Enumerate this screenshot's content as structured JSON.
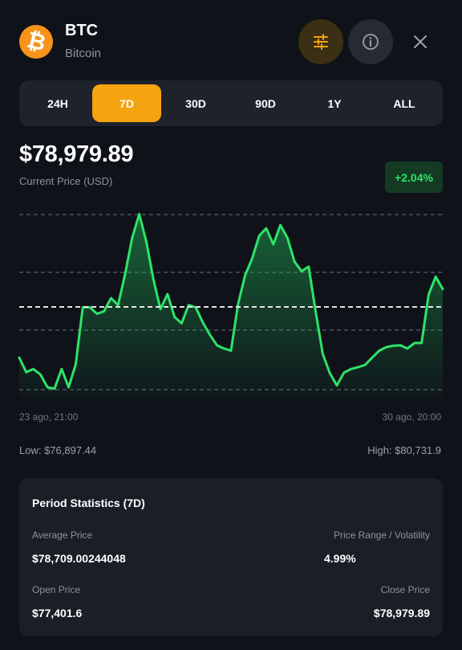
{
  "header": {
    "symbol": "BTC",
    "name": "Bitcoin",
    "logo_glyph": "₿",
    "icons": {
      "filter": "sliders-icon",
      "info": "info-icon",
      "close": "close-icon"
    },
    "colors": {
      "bitcoin": "#f7931a",
      "accent": "#f5a30f"
    }
  },
  "tabs": [
    {
      "label": "24H",
      "active": false
    },
    {
      "label": "7D",
      "active": true
    },
    {
      "label": "30D",
      "active": false
    },
    {
      "label": "90D",
      "active": false
    },
    {
      "label": "1Y",
      "active": false
    },
    {
      "label": "ALL",
      "active": false
    }
  ],
  "price": {
    "value": "$78,979.89",
    "label": "Current Price (USD)",
    "change": "+2.04%",
    "change_color": "#2ee36a"
  },
  "chart": {
    "x_start_label": "23 ago, 21:00",
    "x_end_label": "30 ago, 20:00",
    "low_label": "Low: $76,897.44",
    "high_label": "High: $80,731.9"
  },
  "chart_data": {
    "type": "area",
    "x_start": "23 ago, 21:00",
    "x_end": "30 ago, 20:00",
    "ylim": [
      76897.44,
      80731.9
    ],
    "grid": true,
    "line_color": "#2ee36a",
    "values": [
      77600,
      77280,
      77350,
      77230,
      76950,
      76920,
      77350,
      76950,
      77450,
      78700,
      78700,
      78560,
      78610,
      78900,
      78750,
      79430,
      80220,
      80740,
      80140,
      79320,
      78660,
      78990,
      78490,
      78350,
      78750,
      78700,
      78370,
      78100,
      77870,
      77800,
      77750,
      78770,
      79400,
      79770,
      80270,
      80430,
      80080,
      80500,
      80220,
      79700,
      79490,
      79590,
      78600,
      77680,
      77260,
      76990,
      77270,
      77350,
      77390,
      77440,
      77600,
      77750,
      77830,
      77860,
      77870,
      77800,
      77920,
      77920,
      78980,
      79370,
      79100
    ]
  },
  "stats": {
    "title": "Period Statistics (7D)",
    "avg_label": "Average Price",
    "avg_value": "$78,709.00244048",
    "range_label": "Price Range / Volatility",
    "range_value": "4.99%",
    "open_label": "Open Price",
    "open_value": "$77,401.6",
    "close_label": "Close Price",
    "close_value": "$78,979.89"
  }
}
